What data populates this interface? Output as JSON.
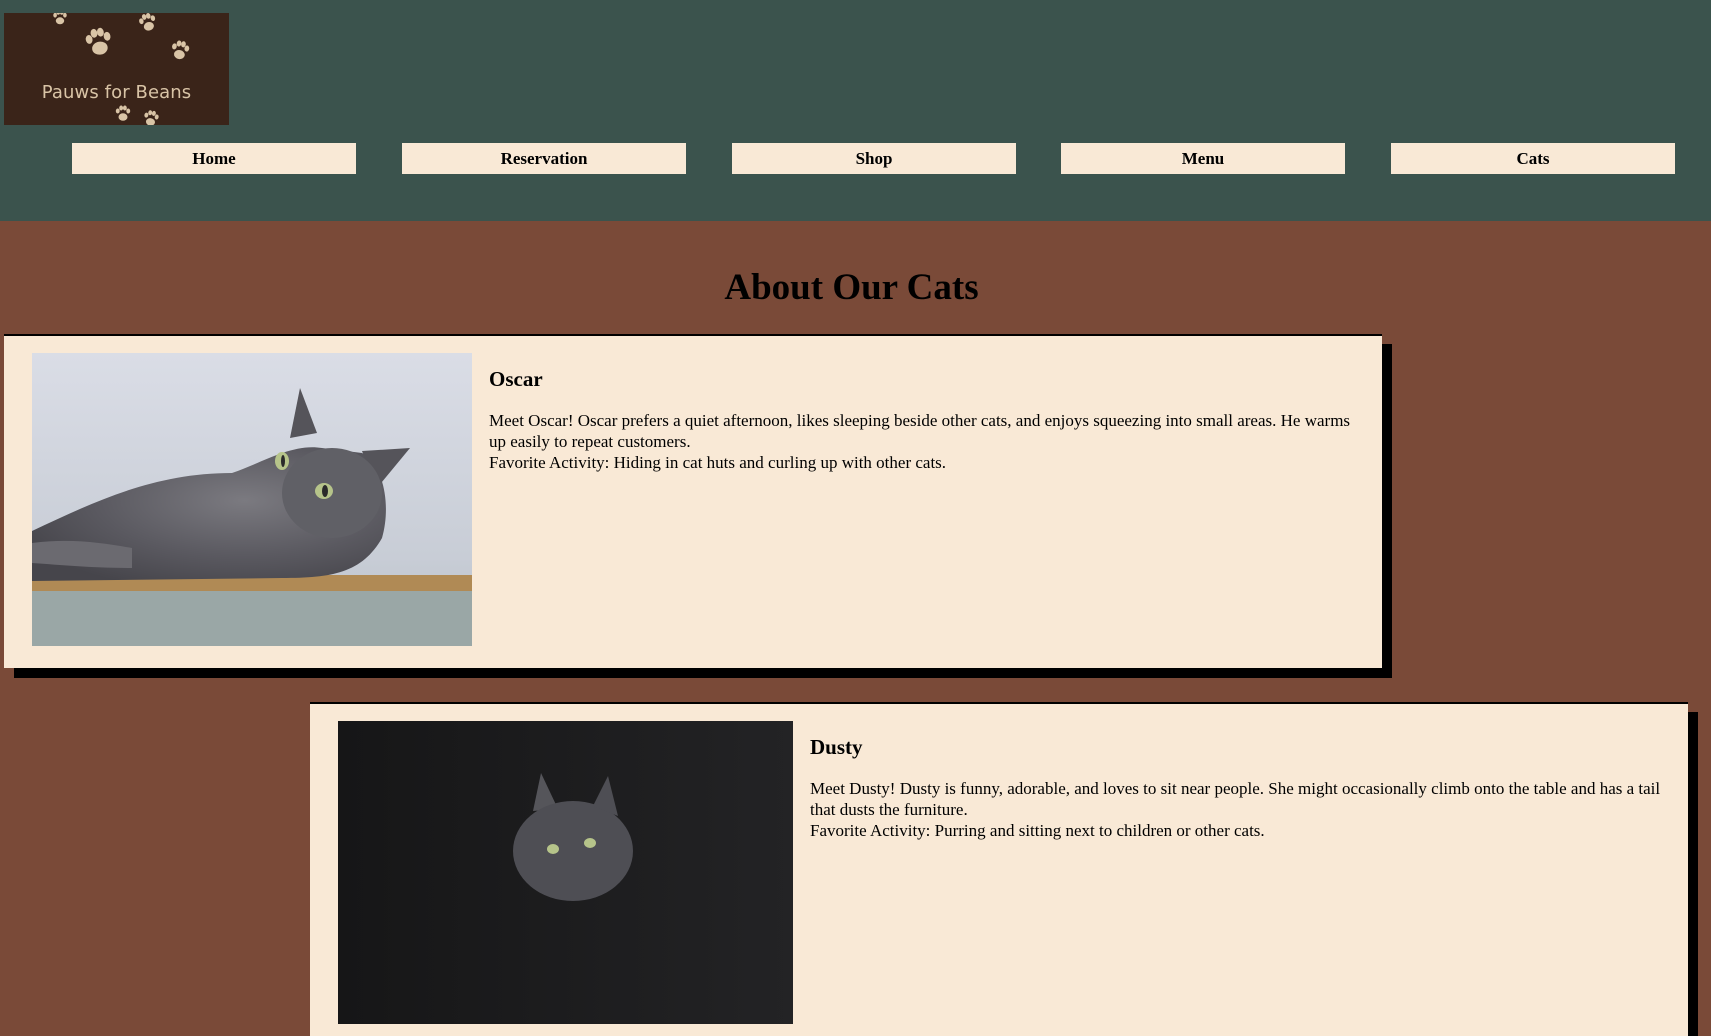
{
  "header": {
    "logo_text": "Pauws for Beans"
  },
  "nav": {
    "items": [
      {
        "label": "Home"
      },
      {
        "label": "Reservation"
      },
      {
        "label": "Shop"
      },
      {
        "label": "Menu"
      },
      {
        "label": "Cats"
      }
    ]
  },
  "main": {
    "title": "About Our Cats",
    "cats": [
      {
        "name": "Oscar",
        "description": "Meet Oscar! Oscar prefers a quiet afternoon, likes sleeping beside other cats, and enjoys squeezing into small areas. He warms up easily to repeat customers.",
        "favorite": "Favorite Activity: Hiding in cat huts and curling up with other cats."
      },
      {
        "name": "Dusty",
        "description": "Meet Dusty! Dusty is funny, adorable, and loves to sit near people. She might occasionally climb onto the table and has a tail that dusts the furniture.",
        "favorite": "Favorite Activity: Purring and sitting next to children or other cats."
      }
    ]
  },
  "colors": {
    "header_bg": "#3b534d",
    "page_bg": "#7a4a38",
    "card_bg": "#f9e9d6",
    "logo_bg": "#3a2419",
    "logo_accent": "#d9c4a6"
  },
  "icons": {
    "logo_decoration": "paw-print-icon"
  }
}
